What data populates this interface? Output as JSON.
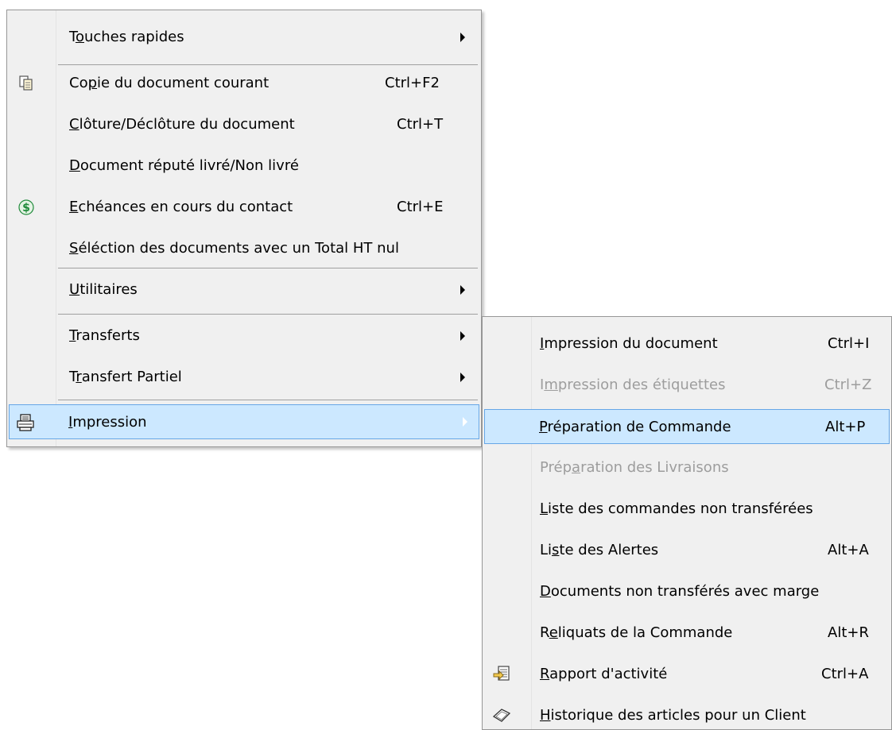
{
  "main_menu": {
    "items": [
      {
        "pre": "T",
        "acc": "o",
        "post": "uches rapides"
      },
      {
        "pre": "Co",
        "acc": "p",
        "post": "ie du document courant",
        "shortcut": "Ctrl+F2"
      },
      {
        "pre": "",
        "acc": "C",
        "post": "lôture/Déclôture du document",
        "shortcut": "Ctrl+T"
      },
      {
        "pre": "",
        "acc": "D",
        "post": "ocument réputé livré/Non livré"
      },
      {
        "pre": "",
        "acc": "E",
        "post": "chéances en cours du contact",
        "shortcut": "Ctrl+E"
      },
      {
        "pre": "",
        "acc": "S",
        "post": "éléction des documents avec un Total HT nul"
      },
      {
        "pre": "",
        "acc": "U",
        "post": "tilitaires"
      },
      {
        "pre": "",
        "acc": "T",
        "post": "ransferts"
      },
      {
        "pre": "T",
        "acc": "r",
        "post": "ansfert Partiel"
      },
      {
        "pre": "",
        "acc": "I",
        "post": "mpression"
      }
    ]
  },
  "submenu": {
    "items": [
      {
        "pre": "",
        "acc": "I",
        "post": "mpression du document",
        "shortcut": "Ctrl+I"
      },
      {
        "pre": "I",
        "acc": "m",
        "post": "pression des étiquettes",
        "shortcut": "Ctrl+Z"
      },
      {
        "pre": "",
        "acc": "P",
        "post": "réparation de Commande",
        "shortcut": "Alt+P"
      },
      {
        "pre": "Prép",
        "acc": "a",
        "post": "ration des Livraisons"
      },
      {
        "pre": "",
        "acc": "L",
        "post": "iste des commandes non transférées"
      },
      {
        "pre": "Li",
        "acc": "s",
        "post": "te des Alertes",
        "shortcut": "Alt+A"
      },
      {
        "pre": "",
        "acc": "D",
        "post": "ocuments non transférés avec marge"
      },
      {
        "pre": "R",
        "acc": "e",
        "post": "liquats de la Commande",
        "shortcut": "Alt+R"
      },
      {
        "pre": "",
        "acc": "R",
        "post": "apport d'activité",
        "shortcut": "Ctrl+A"
      },
      {
        "pre": "",
        "acc": "H",
        "post": "istorique des articles pour un Client"
      }
    ]
  },
  "colors": {
    "menu_bg": "#f0f0f0",
    "highlight_bg": "#cce8ff",
    "highlight_border": "#66a6e6",
    "disabled_text": "#9d9d9d",
    "dollar_icon": "#1f8a3a"
  },
  "icons": {
    "copy": "copy-document-icon",
    "dollar": "dollar-icon",
    "printer": "printer-icon",
    "report": "report-icon",
    "history": "history-icon"
  }
}
